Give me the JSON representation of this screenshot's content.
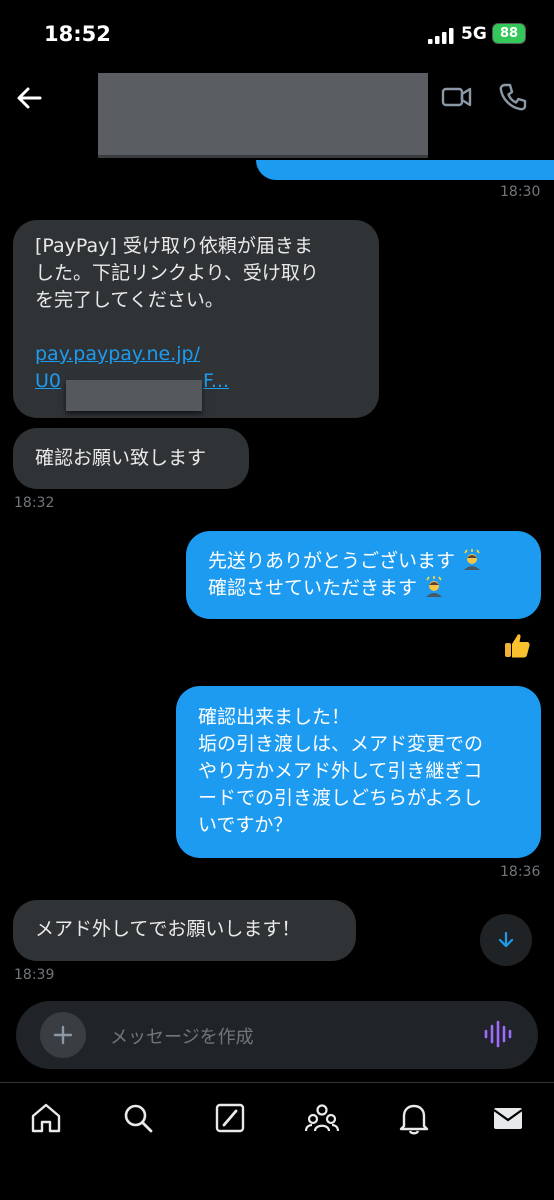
{
  "status_bar": {
    "time": "18:52",
    "network": "5G",
    "battery": "88"
  },
  "header": {
    "back_icon": "arrow-left-icon",
    "video_icon": "video-call-icon",
    "phone_icon": "phone-icon"
  },
  "messages": [
    {
      "from": "them",
      "lines": [
        "[PayPay] 受け取り依頼が届きま",
        "した。下記リンクより、受け取り",
        "を完了してください。"
      ],
      "link_line1": "pay.paypay.ne.jp/",
      "link_line2_start": "U0",
      "link_line2_end": "F..."
    },
    {
      "from": "them",
      "text": "確認お願い致します"
    },
    {
      "from": "me",
      "lines": [
        "先送りありがとうございます",
        "確認させていただきます"
      ]
    },
    {
      "from": "me",
      "reaction": "thumbs-up-icon"
    },
    {
      "from": "me",
      "lines": [
        "確認出来ました！",
        "垢の引き渡しは、メアド変更での",
        "やり方かメアド外して引き継ぎコ",
        "ードでの引き渡しどちらがよろし",
        "いですか？"
      ]
    },
    {
      "from": "them",
      "text": "メアド外してでお願いします！"
    }
  ],
  "timestamps": {
    "t1": "18:30",
    "t2": "18:32",
    "t3": "18:36",
    "t4": "18:39"
  },
  "composer": {
    "placeholder": "メッセージを作成"
  },
  "colors": {
    "accent": "#1d9bf0",
    "bubble_in": "#2f3336",
    "background": "#000000"
  },
  "tab_bar": [
    "home-icon",
    "search-icon",
    "grok-icon",
    "communities-icon",
    "notifications-icon",
    "messages-icon"
  ]
}
